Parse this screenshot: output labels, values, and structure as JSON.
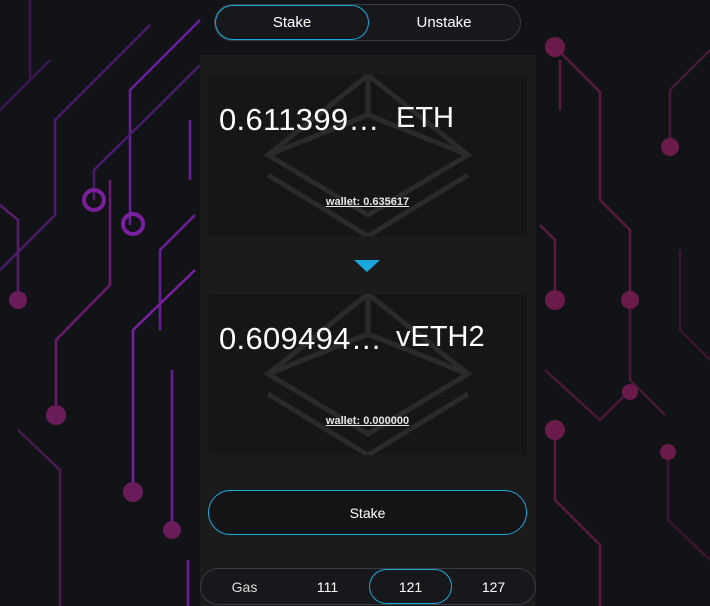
{
  "colors": {
    "background": "#121317",
    "accent": "#19a7dc",
    "circuit_purple": "#7a1fa0",
    "circuit_magenta": "#8e1c64",
    "panel": "#1b1b1c",
    "card": "#161617"
  },
  "tabs": [
    {
      "label": "Stake",
      "active": true
    },
    {
      "label": "Unstake",
      "active": false
    }
  ],
  "from": {
    "amount": "0.611399…",
    "token": "ETH",
    "wallet": "wallet: 0.635617",
    "icon": "ethereum-logo-icon"
  },
  "swap_icon": "triangle-down-icon",
  "to": {
    "amount": "0.609494…",
    "token": "vETH2",
    "wallet": "wallet: 0.000000",
    "icon": "ethereum-logo-icon"
  },
  "action": {
    "label": "Stake"
  },
  "gas": {
    "label": "Gas",
    "options": [
      "111",
      "121",
      "127"
    ],
    "selected": "121"
  }
}
